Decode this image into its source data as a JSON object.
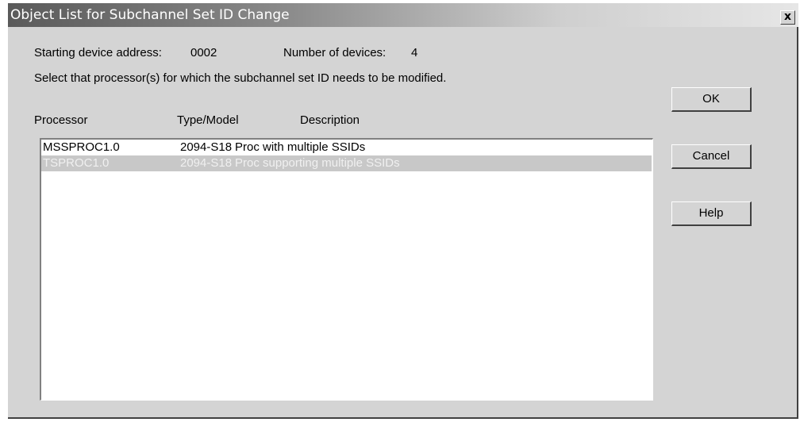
{
  "window": {
    "title": "Object List for Subchannel Set ID Change",
    "close_label": "x"
  },
  "info": {
    "start_label": "Starting device address:",
    "start_value": "0002",
    "count_label": "Number of devices:",
    "count_value": "4",
    "instruction": "Select that processor(s) for which the subchannel set ID needs to be modified."
  },
  "columns": {
    "processor": "Processor",
    "type_model": "Type/Model",
    "description": "Description"
  },
  "rows": [
    {
      "processor": "MSSPROC1.0",
      "type_model": "2094-S18",
      "description": "Proc with multiple SSIDs",
      "selected": false
    },
    {
      "processor": "TSPROC1.0",
      "type_model": "2094-S18",
      "description": "Proc supporting multiple SSIDs",
      "selected": true
    }
  ],
  "buttons": {
    "ok": "OK",
    "cancel": "Cancel",
    "help": "Help"
  }
}
